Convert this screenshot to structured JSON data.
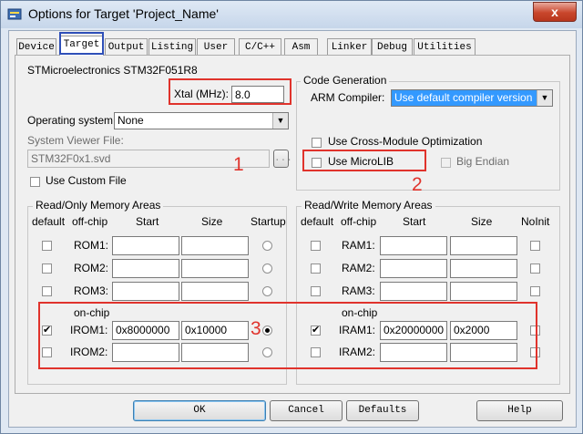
{
  "window": {
    "title": "Options for Target 'Project_Name'",
    "close_glyph": "x"
  },
  "tabs": [
    "Device",
    "Target",
    "Output",
    "Listing",
    "User",
    "C/C++",
    "Asm",
    "Linker",
    "Debug",
    "Utilities"
  ],
  "device": {
    "name": "STMicroelectronics STM32F051R8",
    "xtal_label": "Xtal (MHz):",
    "xtal_value": "8.0",
    "os_label": "Operating system:",
    "os_value": "None",
    "svd_label": "System Viewer File:",
    "svd_value": "STM32F0x1.svd",
    "browse_label": "...",
    "custom_file_label": "Use Custom File",
    "custom_file_checked": false
  },
  "codegen": {
    "group_title": "Code Generation",
    "compiler_label": "ARM Compiler:",
    "compiler_value": "Use default compiler version",
    "cross_module_label": "Use Cross-Module Optimization",
    "cross_module_checked": false,
    "microlib_label": "Use MicroLIB",
    "microlib_checked": false,
    "big_endian_label": "Big Endian",
    "big_endian_checked": false
  },
  "ro_mem": {
    "group_title": "Read/Only Memory Areas",
    "headers": {
      "default": "default",
      "offchip": "off-chip",
      "start": "Start",
      "size": "Size",
      "startup": "Startup"
    },
    "onchip_label": "on-chip",
    "rows": [
      {
        "name": "ROM1:",
        "default": false,
        "start": "",
        "size": "",
        "startup": false
      },
      {
        "name": "ROM2:",
        "default": false,
        "start": "",
        "size": "",
        "startup": false
      },
      {
        "name": "ROM3:",
        "default": false,
        "start": "",
        "size": "",
        "startup": false
      },
      {
        "name": "IROM1:",
        "default": true,
        "start": "0x8000000",
        "size": "0x10000",
        "startup": true
      },
      {
        "name": "IROM2:",
        "default": false,
        "start": "",
        "size": "",
        "startup": false
      }
    ]
  },
  "rw_mem": {
    "group_title": "Read/Write Memory Areas",
    "headers": {
      "default": "default",
      "offchip": "off-chip",
      "start": "Start",
      "size": "Size",
      "noinit": "NoInit"
    },
    "onchip_label": "on-chip",
    "rows": [
      {
        "name": "RAM1:",
        "default": false,
        "start": "",
        "size": "",
        "noinit": false
      },
      {
        "name": "RAM2:",
        "default": false,
        "start": "",
        "size": "",
        "noinit": false
      },
      {
        "name": "RAM3:",
        "default": false,
        "start": "",
        "size": "",
        "noinit": false
      },
      {
        "name": "IRAM1:",
        "default": true,
        "start": "0x20000000",
        "size": "0x2000",
        "noinit": false
      },
      {
        "name": "IRAM2:",
        "default": false,
        "start": "",
        "size": "",
        "noinit": false
      }
    ]
  },
  "annotations": {
    "n1": "1",
    "n2": "2",
    "n3": "3"
  },
  "buttons": {
    "ok": "OK",
    "cancel": "Cancel",
    "defaults": "Defaults",
    "help": "Help"
  },
  "colors": {
    "highlight_red": "#e0332c",
    "highlight_blue": "#2e4fb8",
    "select_blue": "#3399ff"
  }
}
